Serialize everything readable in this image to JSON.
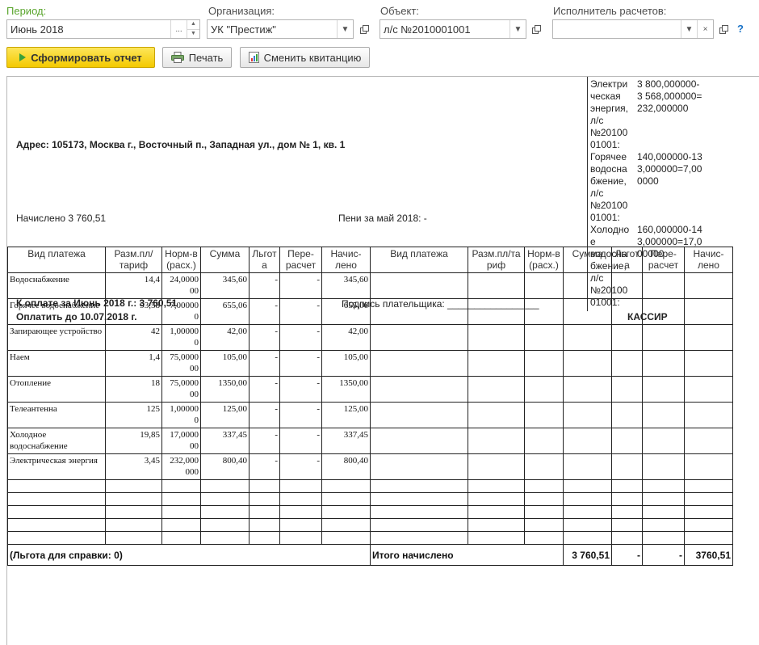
{
  "filters": {
    "period": {
      "label": "Период:",
      "value": "Июнь 2018"
    },
    "organization": {
      "label": "Организация:",
      "value": "УК \"Престиж\""
    },
    "object": {
      "label": "Объект:",
      "value": "л/с №2010001001"
    },
    "executor": {
      "label": "Исполнитель расчетов:",
      "value": ""
    }
  },
  "toolbar": {
    "generate_label": "Сформировать отчет",
    "print_label": "Печать",
    "change_receipt_label": "Сменить квитанцию",
    "help": "?"
  },
  "report": {
    "address": "Адрес: 105173, Москва г., Восточный п., Западная ул., дом № 1, кв. 1",
    "accrued": "Начислено   3 760,51",
    "penalty": "Пени за май 2018: -",
    "to_pay": "К оплате за Июнь 2018 г.: 3 760,51",
    "pay_until": "Оплатить до 10.07.2018 г.",
    "signature": "Подпись плательщика: _________________",
    "cashier": "КАССИР",
    "side_notes": [
      {
        "k": [
          "Электри",
          "ческая",
          "энергия,",
          "л/с",
          "№20100",
          "01001:"
        ],
        "v": [
          "3 800,000000-",
          "3 568,000000=",
          "232,000000"
        ]
      },
      {
        "k": [
          "Горячее",
          "водосна",
          "бжение,",
          "л/с",
          "№20100",
          "01001:"
        ],
        "v": [
          "140,000000-13",
          "3,000000=7,00",
          "0000"
        ]
      },
      {
        "k": [
          "Холодно",
          "е",
          "водосна",
          "бжение,",
          "л/с",
          "№20100",
          "01001:"
        ],
        "v": [
          "160,000000-14",
          "3,000000=17,0",
          "00000"
        ]
      }
    ]
  },
  "table": {
    "headers": [
      "Вид платежа",
      "Разм.пл/ тариф",
      "Норм-в (расх.)",
      "Сумма",
      "Льгот а",
      "Пере- расчет",
      "Начис- лено",
      "Вид платежа",
      "Разм.пл/та риф",
      "Норм-в (расх.)",
      "Сумма",
      "Льгот а",
      "Пере- расчет",
      "Начис- лено"
    ],
    "rows": [
      {
        "name": "Водоснабжение",
        "rate": "14,4",
        "norm": "24,0000 00",
        "sum": "345,60",
        "benefit": "-",
        "recalc": "-",
        "accrued": "345,60"
      },
      {
        "name": "Горячее водоснабжение",
        "rate": "93,58",
        "norm": "7,00000 0",
        "sum": "655,06",
        "benefit": "-",
        "recalc": "-",
        "accrued": "655,06"
      },
      {
        "name": "Запирающее устройство",
        "rate": "42",
        "norm": "1,00000 0",
        "sum": "42,00",
        "benefit": "-",
        "recalc": "-",
        "accrued": "42,00"
      },
      {
        "name": "Наем",
        "rate": "1,4",
        "norm": "75,0000 00",
        "sum": "105,00",
        "benefit": "-",
        "recalc": "-",
        "accrued": "105,00"
      },
      {
        "name": "Отопление",
        "rate": "18",
        "norm": "75,0000 00",
        "sum": "1350,00",
        "benefit": "-",
        "recalc": "-",
        "accrued": "1350,00"
      },
      {
        "name": "Телеантенна",
        "rate": "125",
        "norm": "1,00000 0",
        "sum": "125,00",
        "benefit": "-",
        "recalc": "-",
        "accrued": "125,00"
      },
      {
        "name": "Холодное водоснабжение",
        "rate": "19,85",
        "norm": "17,0000 00",
        "sum": "337,45",
        "benefit": "-",
        "recalc": "-",
        "accrued": "337,45"
      },
      {
        "name": "Электрическая энергия",
        "rate": "3,45",
        "norm": "232,000 000",
        "sum": "800,40",
        "benefit": "-",
        "recalc": "-",
        "accrued": "800,40"
      }
    ],
    "footer": {
      "benefit_note": "(Льгота для справки: 0)",
      "total_label": "Итого начислено",
      "total_sum": "3 760,51",
      "total_benefit": "-",
      "total_recalc": "-",
      "total_accrued": "3760,51"
    }
  }
}
